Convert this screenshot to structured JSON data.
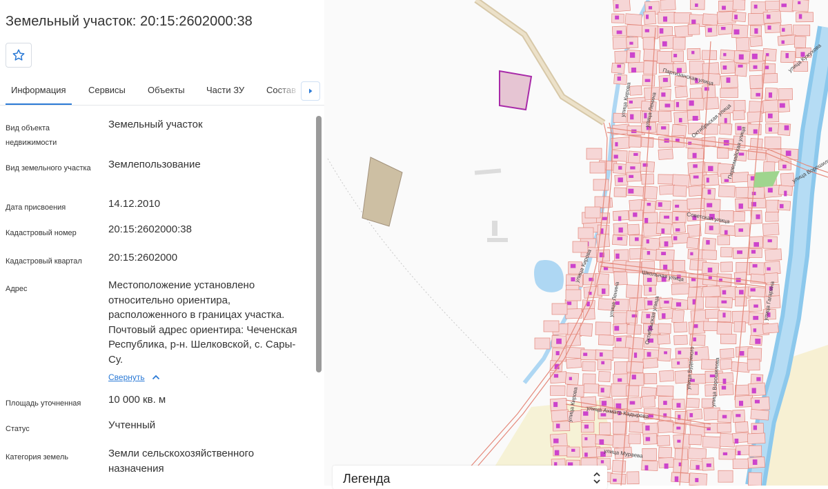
{
  "panel": {
    "title": "Земельный участок: 20:15:2602000:38",
    "favorite_icon": "star-icon",
    "tabs": [
      {
        "label": "Информация",
        "active": true
      },
      {
        "label": "Сервисы"
      },
      {
        "label": "Объекты"
      },
      {
        "label": "Части ЗУ"
      },
      {
        "label": "Состав"
      }
    ],
    "tabs_next_icon": "chevron-right-icon",
    "fields": [
      {
        "label": "Вид объекта недвижимости",
        "value": "Земельный участок"
      },
      {
        "label": "Вид земельного участка",
        "value": "Землепользование"
      },
      {
        "label": "Дата присвоения",
        "value": "14.12.2010"
      },
      {
        "label": "Кадастровый номер",
        "value": "20:15:2602000:38"
      },
      {
        "label": "Кадастровый квартал",
        "value": "20:15:2602000"
      },
      {
        "label": "Адрес",
        "value": "Местоположение установлено относительно ориентира, расположенного в границах участка. Почтовый адрес ориентира: Чеченская Республика, р-н. Шелковской, с. Сары-Су."
      },
      {
        "label": "Площадь уточненная",
        "value": "10 000 кв. м"
      },
      {
        "label": "Статус",
        "value": "Учтенный"
      },
      {
        "label": "Категория земель",
        "value": "Земли сельскохозяйственного назначения"
      }
    ],
    "collapse_label": "Свернуть"
  },
  "map": {
    "street_labels": [
      "улица Кирова",
      "Партизанская улица",
      "улица Ленина",
      "Октябрьская улица",
      "Первомайская улица",
      "улица Кужухова",
      "улица Ворошилова",
      "Советская улица",
      "улица Кирова",
      "Школьная улица",
      "улица Ленина",
      "Октябрьская улица",
      "улица Буденного",
      "улица Гагарина",
      "улица Ахмата Кадырова",
      "улица Ворошилова",
      "улица Кирова",
      "улица Мураева"
    ],
    "colors": {
      "parcel_fill": "#f6d6d6",
      "parcel_stroke": "#e3877b",
      "building": "#cc44cc",
      "water": "#aed7f3",
      "selected": "#a82aa8",
      "field": "#cdbfa3"
    }
  },
  "legend": {
    "title": "Легенда",
    "toggle_icon": "chevron-up-down-icon"
  }
}
